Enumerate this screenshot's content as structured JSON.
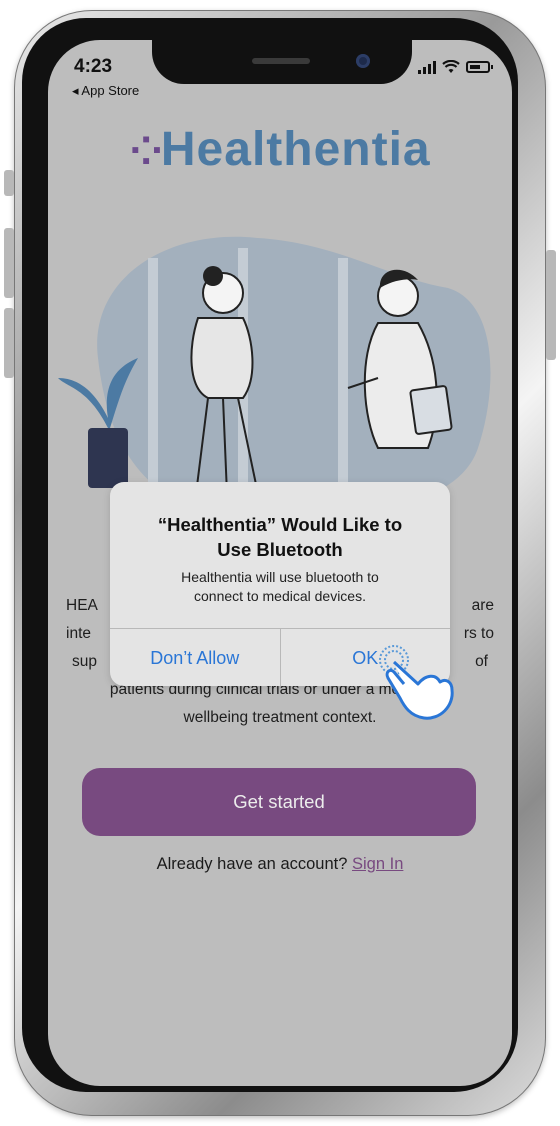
{
  "status_bar": {
    "time": "4:23",
    "back_label": "◂ App Store"
  },
  "logo": {
    "text": "Healthentia"
  },
  "description": {
    "line1_left": "HEA",
    "line1_right": "are",
    "line2_left": "inte",
    "line2_right": "rs to",
    "line3_left": "sup",
    "line3_right": "of",
    "line4": "patients during clinical trials or under a medical or",
    "line5": "wellbeing treatment context."
  },
  "dialog": {
    "title_line1": "“Healthentia” Would Like to",
    "title_line2": "Use Bluetooth",
    "message_line1": "Healthentia will use bluetooth to",
    "message_line2": "connect to medical devices.",
    "deny_label": "Don’t Allow",
    "ok_label": "OK"
  },
  "get_started_label": "Get started",
  "signin": {
    "prompt": "Already have an account?",
    "link_label": "Sign In"
  },
  "colors": {
    "brand_purple": "#784a80",
    "logo_blue": "#4c7aa3",
    "ios_blue": "#2a76d6",
    "screen_bg": "#bdbdbd"
  },
  "icons": {
    "tap_indicator": "hand-pointer-icon"
  }
}
